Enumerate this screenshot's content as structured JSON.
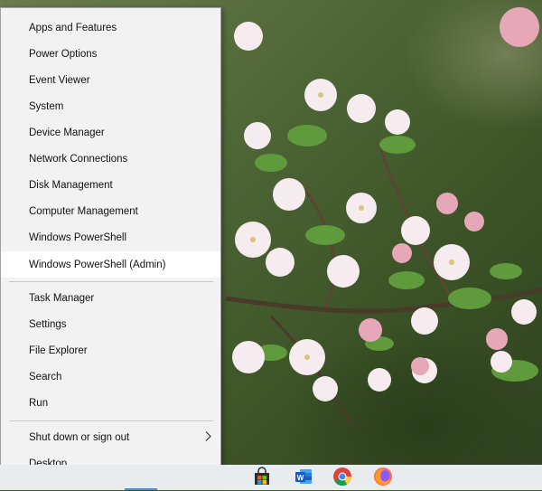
{
  "menu": {
    "items": [
      {
        "label": "Apps and Features"
      },
      {
        "label": "Power Options"
      },
      {
        "label": "Event Viewer"
      },
      {
        "label": "System"
      },
      {
        "label": "Device Manager"
      },
      {
        "label": "Network Connections"
      },
      {
        "label": "Disk Management"
      },
      {
        "label": "Computer Management"
      },
      {
        "label": "Windows PowerShell"
      },
      {
        "label": "Windows PowerShell (Admin)",
        "highlighted": true
      },
      {
        "label": "Task Manager"
      },
      {
        "label": "Settings"
      },
      {
        "label": "File Explorer"
      },
      {
        "label": "Search"
      },
      {
        "label": "Run"
      },
      {
        "label": "Shut down or sign out",
        "submenu": true
      },
      {
        "label": "Desktop"
      }
    ]
  },
  "taskbar": {
    "icons": [
      "microsoft-store-icon",
      "word-icon",
      "chrome-icon",
      "firefox-icon"
    ]
  },
  "colors": {
    "menu_bg": "#f2f2f2",
    "highlight_bg": "#ffffff",
    "taskbar_bg": "#e8ecef"
  }
}
